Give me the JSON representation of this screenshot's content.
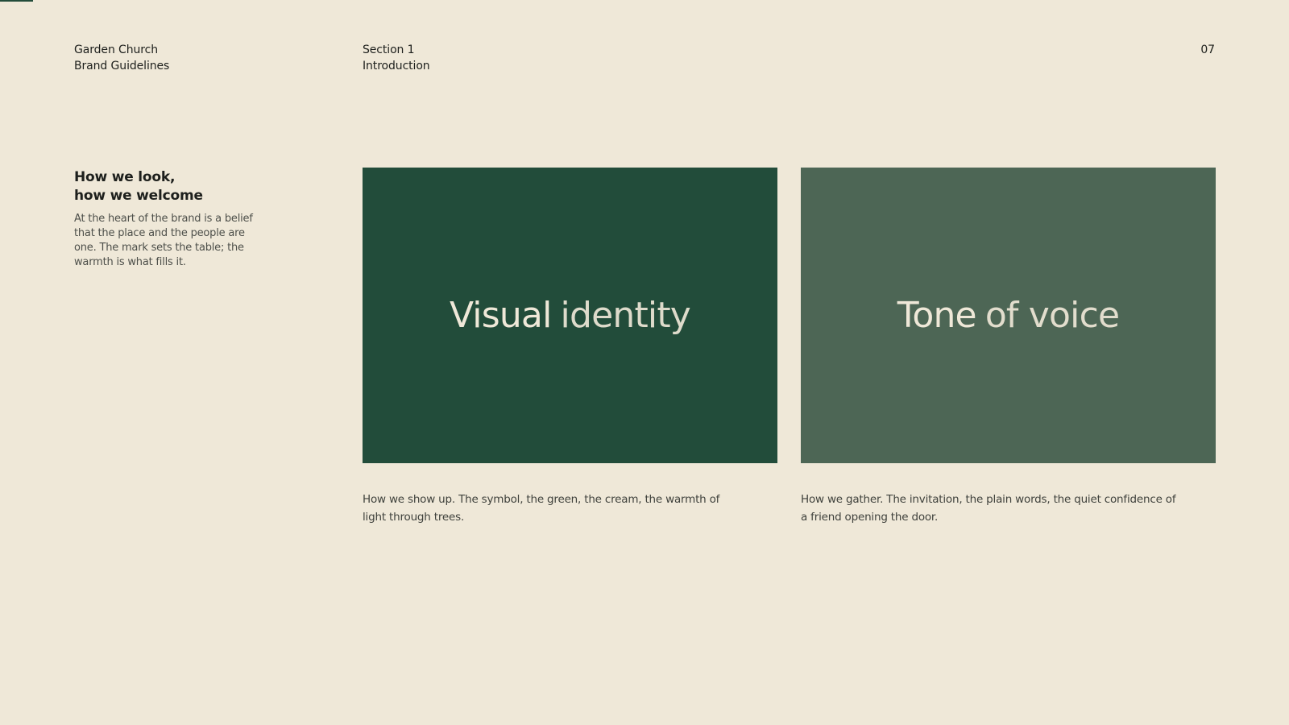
{
  "header": {
    "brand_line1": "Garden Church",
    "brand_line2": "Brand Guidelines",
    "section_line1": "Section 1",
    "section_line2": "Introduction",
    "page_number": "07"
  },
  "intro": {
    "title_line1": "How we look,",
    "title_line2": "how we welcome",
    "body": "At the heart of the brand is a belief that the place and the people are one. The mark sets the table; the warmth is what fills it."
  },
  "cards": [
    {
      "title_strong": "Visual",
      "title_light": "identity",
      "caption": "How we show up. The symbol, the green, the cream, the warmth of light through trees.",
      "color": "#224c3a"
    },
    {
      "title_strong": "Tone",
      "title_light": "of voice",
      "caption": "How we gather. The invitation, the plain words, the quiet confidence of a friend opening the door.",
      "color": "#4d6655"
    }
  ],
  "colors": {
    "background": "#efe8d8",
    "accent": "#224c3a"
  }
}
